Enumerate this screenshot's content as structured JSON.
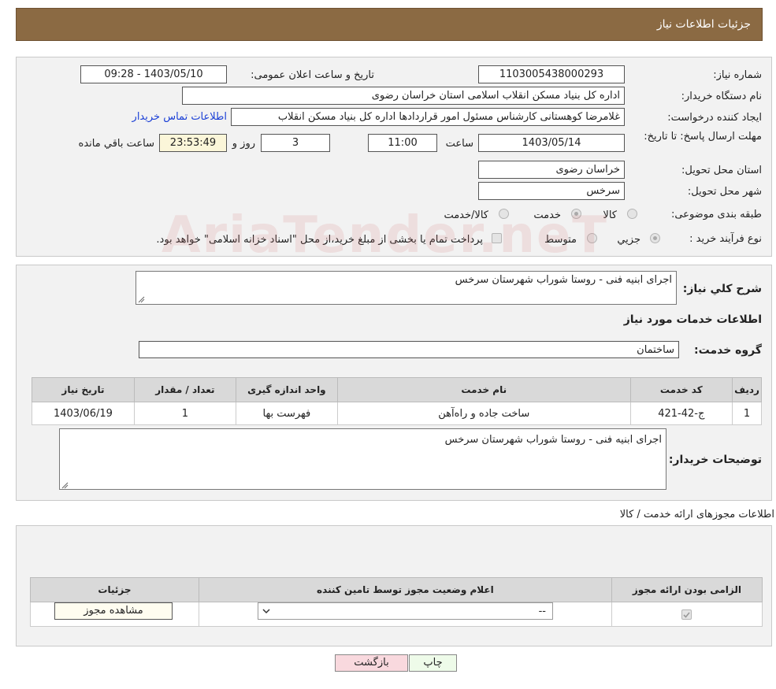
{
  "header": {
    "title": "جزئیات اطلاعات نیاز"
  },
  "watermark": "AriaTender.neT",
  "info": {
    "need_no_label": "شماره نیاز:",
    "need_no": "1103005438000293",
    "announce_label": "تاریخ و ساعت اعلان عمومی:",
    "announce_value": "1403/05/10 - 09:28",
    "buyer_org_label": "نام دستگاه خریدار:",
    "buyer_org": "اداره کل بنیاد مسکن انقلاب اسلامی استان خراسان رضوی",
    "creator_label": "ایجاد کننده درخواست:",
    "creator": "غلامرضا کوهستانی کارشناس مسئول امور قراردادها اداره کل بنیاد مسکن انقلاب",
    "contact_link": "اطلاعات تماس خریدار",
    "deadline_label": "مهلت ارسال پاسخ: تا تاریخ:",
    "deadline_date": "1403/05/14",
    "time_label": "ساعت",
    "deadline_time": "11:00",
    "days": "3",
    "days_label": "روز و",
    "remaining": "23:53:49",
    "remaining_label": "ساعت باقي مانده",
    "province_label": "استان محل تحویل:",
    "province": "خراسان رضوی",
    "city_label": "شهر محل تحویل:",
    "city": "سرخس",
    "category_label": "طبقه بندی موضوعی:",
    "cat_goods": "کالا",
    "cat_service": "خدمت",
    "cat_both": "کالا/خدمت",
    "process_label": "نوع فرآیند خرید :",
    "proc_partial": "جزیي",
    "proc_medium": "متوسط",
    "proc_note": "پرداخت تمام یا بخشی از مبلغ خرید،از محل \"اسناد خزانه اسلامی\" خواهد بود."
  },
  "details": {
    "summary_label": "شرح کلي نياز:",
    "summary": "اجرای ابنیه فنی - روستا شوراب شهرستان سرخس",
    "services_title": "اطلاعات خدمات مورد نیاز",
    "group_label": "گروه خدمت:",
    "group": "ساختمان",
    "table": {
      "headers": [
        "ردیف",
        "کد خدمت",
        "نام خدمت",
        "واحد اندازه گیری",
        "تعداد / مقدار",
        "تاریخ نیاز"
      ],
      "rows": [
        [
          "1",
          "ج-42-421",
          "ساخت جاده و راه‌آهن",
          "فهرست بها",
          "1",
          "1403/06/19"
        ]
      ]
    },
    "buyer_notes_label": "توضیحات خریدار:",
    "buyer_notes": "اجرای ابنیه فنی - روستا شوراب شهرستان سرخس"
  },
  "licenses": {
    "title": "اطلاعات مجوزهای ارائه خدمت / کالا",
    "headers": [
      "الزامی بودن ارائه مجوز",
      "اعلام وضعیت مجوز توسط تامین کننده",
      "جزئیات"
    ],
    "select_value": "--",
    "view_button": "مشاهده مجوز"
  },
  "buttons": {
    "print": "چاپ",
    "back": "بازگشت"
  },
  "colors": {
    "header": "#8b6a43",
    "back_button": "#f9d9de",
    "print_button": "#eefbe9",
    "link": "#1a3fd6"
  }
}
